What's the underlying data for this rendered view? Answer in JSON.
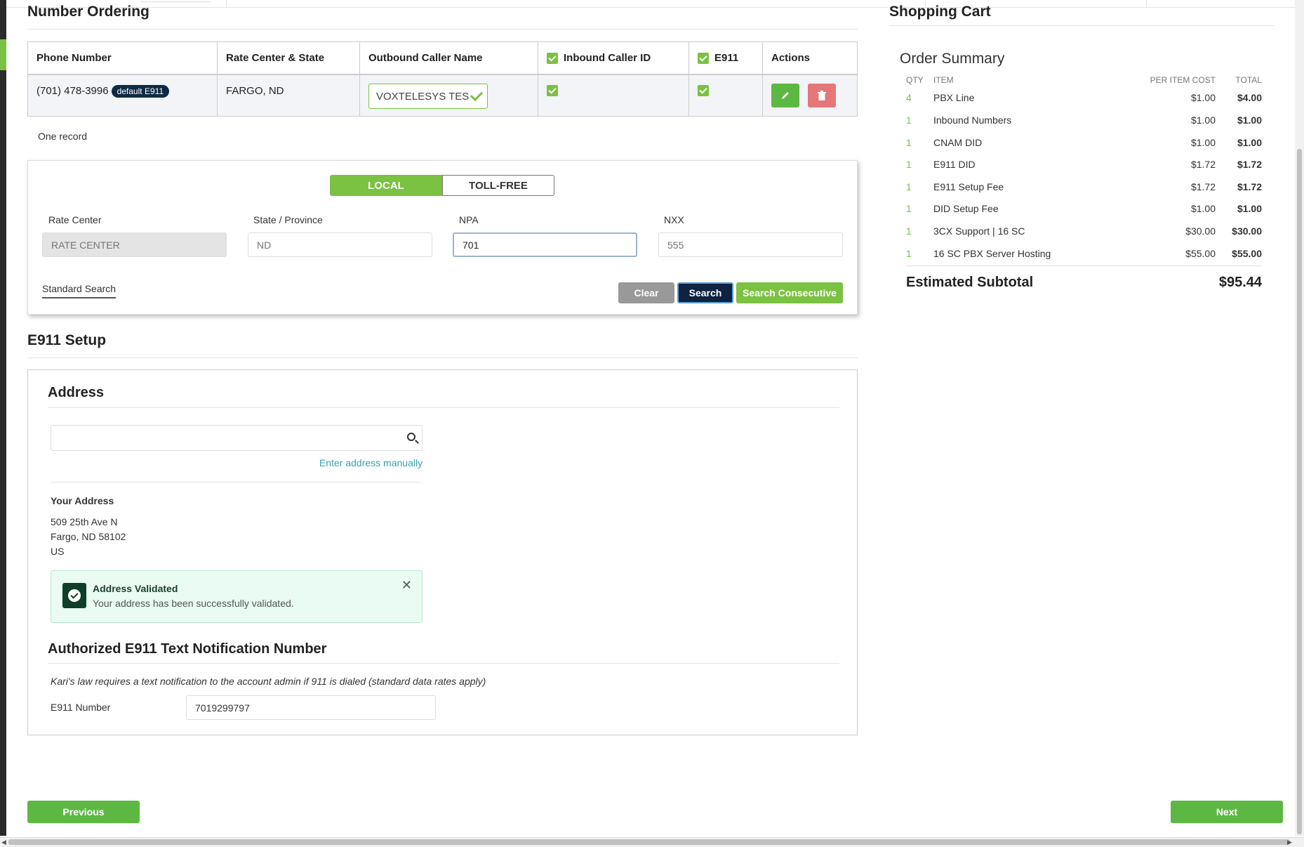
{
  "number_ordering": {
    "title": "Number Ordering",
    "headers": {
      "phone": "Phone Number",
      "rate_center": "Rate Center & State",
      "outbound": "Outbound Caller Name",
      "inbound": "Inbound Caller ID",
      "e911": "E911",
      "actions": "Actions"
    },
    "row": {
      "phone": "(701) 478-3996",
      "badge": "default E911",
      "rate_center": "FARGO, ND",
      "caller_name": "VOXTELESYS TES"
    },
    "record_count": "One record"
  },
  "search": {
    "tabs": {
      "local": "LOCAL",
      "toll_free": "TOLL-FREE"
    },
    "labels": {
      "rate_center": "Rate Center",
      "state": "State / Province",
      "npa": "NPA",
      "nxx": "NXX"
    },
    "placeholders": {
      "rate_center": "RATE CENTER",
      "state": "ND",
      "nxx": "555"
    },
    "values": {
      "npa": "701"
    },
    "standard_search": "Standard Search",
    "buttons": {
      "clear": "Clear",
      "search": "Search",
      "consecutive": "Search Consecutive"
    }
  },
  "e911": {
    "title": "E911 Setup",
    "address_heading": "Address",
    "enter_manually": "Enter address manually",
    "your_address_label": "Your Address",
    "address_lines": [
      "509 25th Ave N",
      "Fargo, ND 58102",
      "US"
    ],
    "validated_title": "Address Validated",
    "validated_text": "Your address has been successfully validated.",
    "auth_heading": "Authorized E911 Text Notification Number",
    "karis_law": "Kari's law requires a text notification to the account admin if 911 is dialed (standard data rates apply)",
    "number_label": "E911 Number",
    "number_value": "7019299797"
  },
  "cart": {
    "title": "Shopping Cart",
    "summary_title": "Order Summary",
    "headers": {
      "qty": "QTY",
      "item": "ITEM",
      "per_item": "PER ITEM COST",
      "total": "TOTAL"
    },
    "items": [
      {
        "qty": "4",
        "item": "PBX Line",
        "price": "$1.00",
        "total": "$4.00"
      },
      {
        "qty": "1",
        "item": "Inbound Numbers",
        "price": "$1.00",
        "total": "$1.00"
      },
      {
        "qty": "1",
        "item": "CNAM DID",
        "price": "$1.00",
        "total": "$1.00"
      },
      {
        "qty": "1",
        "item": "E911 DID",
        "price": "$1.72",
        "total": "$1.72"
      },
      {
        "qty": "1",
        "item": "E911 Setup Fee",
        "price": "$1.72",
        "total": "$1.72"
      },
      {
        "qty": "1",
        "item": "DID Setup Fee",
        "price": "$1.00",
        "total": "$1.00"
      },
      {
        "qty": "1",
        "item": "3CX Support | 16 SC",
        "price": "$30.00",
        "total": "$30.00"
      },
      {
        "qty": "1",
        "item": "16 SC PBX Server Hosting",
        "price": "$55.00",
        "total": "$55.00"
      }
    ],
    "subtotal_label": "Estimated Subtotal",
    "subtotal_value": "$95.44"
  },
  "nav": {
    "previous": "Previous",
    "next": "Next"
  },
  "colors": {
    "accent": "#7bc142",
    "navy": "#0e2340",
    "danger": "#e4777a"
  }
}
